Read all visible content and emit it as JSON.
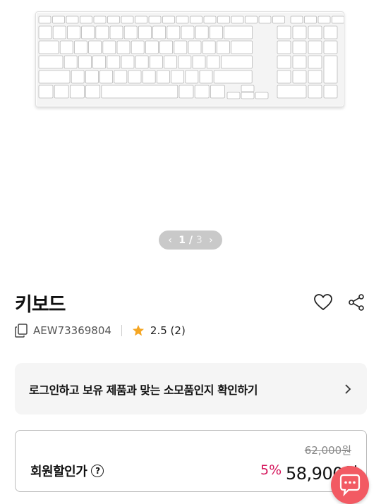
{
  "product": {
    "title": "키보드",
    "model": "AEW73369804",
    "rating": "2.5 (2)"
  },
  "gallery": {
    "current": "1",
    "separator": "/",
    "total": "3"
  },
  "login_prompt": {
    "text": "로그인하고 보유 제품과 맞는 소모품인지 확인하기"
  },
  "price": {
    "original": "62,000원",
    "member_label": "회원할인가",
    "help_glyph": "?",
    "discount": "5%",
    "final": "58,900원"
  },
  "colors": {
    "discount": "#d4145a",
    "chat_button": "#f25a63",
    "star": "#f5a623"
  },
  "icons": {
    "wishlist": "heart-icon",
    "share": "share-icon",
    "copy": "copy-icon",
    "rating": "star-icon",
    "chat": "chat-icon"
  }
}
